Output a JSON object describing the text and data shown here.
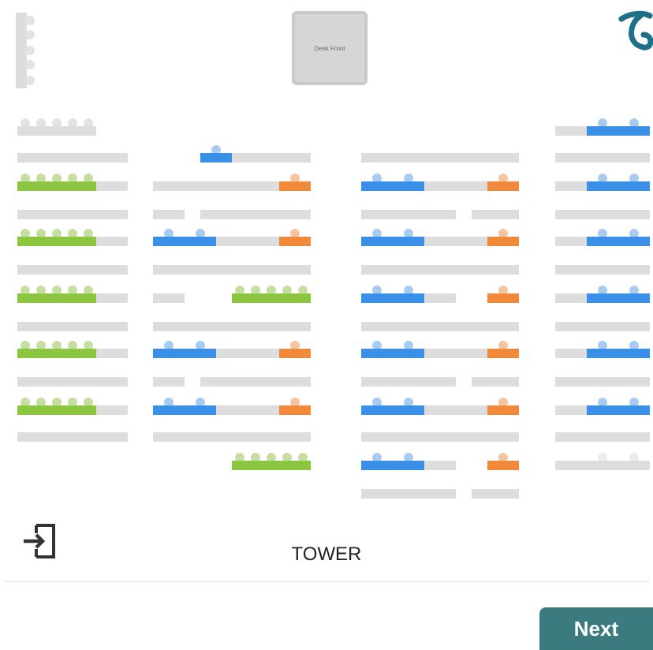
{
  "side_desk": {
    "seats": [
      {
        "kind": "closed"
      },
      {
        "kind": "closed"
      },
      {
        "kind": "closed"
      },
      {
        "kind": "closed"
      },
      {
        "kind": "closed"
      }
    ]
  },
  "desk_front": {
    "label": "Desk Front"
  },
  "plan": {
    "columns": [
      {
        "rows": [
          {
            "seats": [
              {
                "kind": "closed"
              },
              {
                "kind": "closed"
              },
              {
                "kind": "closed"
              },
              {
                "kind": "closed"
              },
              {
                "kind": "closed"
              },
              {
                "kind": "gap"
              },
              {
                "kind": "gap"
              }
            ]
          },
          {
            "seats": [
              {
                "kind": "blocked"
              },
              {
                "kind": "blocked"
              },
              {
                "kind": "blocked"
              },
              {
                "kind": "blocked"
              },
              {
                "kind": "blocked"
              },
              {
                "kind": "blocked"
              },
              {
                "kind": "blocked"
              }
            ]
          },
          {
            "seats": [
              {
                "kind": "free"
              },
              {
                "kind": "free"
              },
              {
                "kind": "free"
              },
              {
                "kind": "free"
              },
              {
                "kind": "free"
              },
              {
                "kind": "blocked"
              },
              {
                "kind": "blocked"
              }
            ]
          },
          {
            "seats": [
              {
                "kind": "blocked"
              },
              {
                "kind": "blocked"
              },
              {
                "kind": "blocked"
              },
              {
                "kind": "blocked"
              },
              {
                "kind": "blocked"
              },
              {
                "kind": "blocked"
              },
              {
                "kind": "blocked"
              }
            ]
          },
          {
            "seats": [
              {
                "kind": "free"
              },
              {
                "kind": "free"
              },
              {
                "kind": "free"
              },
              {
                "kind": "free"
              },
              {
                "kind": "free"
              },
              {
                "kind": "blocked"
              },
              {
                "kind": "blocked"
              }
            ]
          },
          {
            "seats": [
              {
                "kind": "blocked"
              },
              {
                "kind": "blocked"
              },
              {
                "kind": "blocked"
              },
              {
                "kind": "blocked"
              },
              {
                "kind": "blocked"
              },
              {
                "kind": "blocked"
              },
              {
                "kind": "blocked"
              }
            ]
          },
          {
            "seats": [
              {
                "kind": "free"
              },
              {
                "kind": "free"
              },
              {
                "kind": "free"
              },
              {
                "kind": "free"
              },
              {
                "kind": "free"
              },
              {
                "kind": "blocked"
              },
              {
                "kind": "blocked"
              }
            ]
          },
          {
            "seats": [
              {
                "kind": "blocked"
              },
              {
                "kind": "blocked"
              },
              {
                "kind": "blocked"
              },
              {
                "kind": "blocked"
              },
              {
                "kind": "blocked"
              },
              {
                "kind": "blocked"
              },
              {
                "kind": "blocked"
              }
            ]
          },
          {
            "seats": [
              {
                "kind": "free"
              },
              {
                "kind": "free"
              },
              {
                "kind": "free"
              },
              {
                "kind": "free"
              },
              {
                "kind": "free"
              },
              {
                "kind": "blocked"
              },
              {
                "kind": "blocked"
              }
            ]
          },
          {
            "seats": [
              {
                "kind": "blocked"
              },
              {
                "kind": "blocked"
              },
              {
                "kind": "blocked"
              },
              {
                "kind": "blocked"
              },
              {
                "kind": "blocked"
              },
              {
                "kind": "blocked"
              },
              {
                "kind": "blocked"
              }
            ]
          },
          {
            "seats": [
              {
                "kind": "free"
              },
              {
                "kind": "free"
              },
              {
                "kind": "free"
              },
              {
                "kind": "free"
              },
              {
                "kind": "free"
              },
              {
                "kind": "blocked"
              },
              {
                "kind": "blocked"
              }
            ]
          },
          {
            "seats": [
              {
                "kind": "blocked"
              },
              {
                "kind": "blocked"
              },
              {
                "kind": "blocked"
              },
              {
                "kind": "blocked"
              },
              {
                "kind": "blocked"
              },
              {
                "kind": "blocked"
              },
              {
                "kind": "blocked"
              }
            ]
          }
        ]
      },
      {
        "rows": [
          {
            "seats": [
              {
                "kind": "gap"
              }
            ]
          },
          {
            "seats": [
              {
                "kind": "gap"
              },
              {
                "kind": "gap"
              },
              {
                "kind": "gap"
              },
              {
                "kind": "booked"
              },
              {
                "kind": "blocked"
              },
              {
                "kind": "blocked"
              },
              {
                "kind": "blocked"
              },
              {
                "kind": "blocked"
              },
              {
                "kind": "blocked"
              }
            ]
          },
          {
            "seats": [
              {
                "kind": "blocked"
              },
              {
                "kind": "blocked"
              },
              {
                "kind": "blocked"
              },
              {
                "kind": "blocked"
              },
              {
                "kind": "blocked"
              },
              {
                "kind": "blocked"
              },
              {
                "kind": "blocked"
              },
              {
                "kind": "blocked"
              },
              {
                "kind": "selected"
              }
            ]
          },
          {
            "seats": [
              {
                "kind": "blocked"
              },
              {
                "kind": "blocked"
              },
              {
                "kind": "gap"
              },
              {
                "kind": "blocked"
              },
              {
                "kind": "blocked"
              },
              {
                "kind": "blocked"
              },
              {
                "kind": "blocked"
              },
              {
                "kind": "blocked"
              },
              {
                "kind": "blocked"
              },
              {
                "kind": "blocked"
              }
            ]
          },
          {
            "seats": [
              {
                "kind": "booked"
              },
              {
                "kind": "booked"
              },
              {
                "kind": "blocked"
              },
              {
                "kind": "blocked"
              },
              {
                "kind": "blocked"
              },
              {
                "kind": "blocked"
              },
              {
                "kind": "selected"
              }
            ]
          },
          {
            "seats": [
              {
                "kind": "blocked"
              },
              {
                "kind": "blocked"
              },
              {
                "kind": "blocked"
              },
              {
                "kind": "blocked"
              },
              {
                "kind": "blocked"
              },
              {
                "kind": "blocked"
              },
              {
                "kind": "blocked"
              },
              {
                "kind": "blocked"
              },
              {
                "kind": "blocked"
              },
              {
                "kind": "blocked"
              }
            ]
          },
          {
            "seats": [
              {
                "kind": "blocked"
              },
              {
                "kind": "blocked"
              },
              {
                "kind": "gap"
              },
              {
                "kind": "gap"
              },
              {
                "kind": "gap"
              },
              {
                "kind": "free"
              },
              {
                "kind": "free"
              },
              {
                "kind": "free"
              },
              {
                "kind": "free"
              },
              {
                "kind": "free"
              }
            ]
          },
          {
            "seats": [
              {
                "kind": "blocked"
              },
              {
                "kind": "blocked"
              },
              {
                "kind": "blocked"
              },
              {
                "kind": "blocked"
              },
              {
                "kind": "blocked"
              },
              {
                "kind": "blocked"
              },
              {
                "kind": "blocked"
              },
              {
                "kind": "blocked"
              },
              {
                "kind": "blocked"
              },
              {
                "kind": "blocked"
              }
            ]
          },
          {
            "seats": [
              {
                "kind": "booked"
              },
              {
                "kind": "booked"
              },
              {
                "kind": "blocked"
              },
              {
                "kind": "blocked"
              },
              {
                "kind": "blocked"
              },
              {
                "kind": "blocked"
              },
              {
                "kind": "selected"
              }
            ]
          },
          {
            "seats": [
              {
                "kind": "blocked"
              },
              {
                "kind": "blocked"
              },
              {
                "kind": "gap"
              },
              {
                "kind": "blocked"
              },
              {
                "kind": "blocked"
              },
              {
                "kind": "blocked"
              },
              {
                "kind": "blocked"
              },
              {
                "kind": "blocked"
              },
              {
                "kind": "blocked"
              },
              {
                "kind": "blocked"
              }
            ]
          },
          {
            "seats": [
              {
                "kind": "booked"
              },
              {
                "kind": "booked"
              },
              {
                "kind": "blocked"
              },
              {
                "kind": "blocked"
              },
              {
                "kind": "blocked"
              },
              {
                "kind": "blocked"
              },
              {
                "kind": "selected"
              }
            ]
          },
          {
            "seats": [
              {
                "kind": "blocked"
              },
              {
                "kind": "blocked"
              },
              {
                "kind": "blocked"
              },
              {
                "kind": "blocked"
              },
              {
                "kind": "blocked"
              },
              {
                "kind": "blocked"
              },
              {
                "kind": "blocked"
              },
              {
                "kind": "blocked"
              },
              {
                "kind": "blocked"
              },
              {
                "kind": "blocked"
              }
            ]
          },
          {
            "seats": [
              {
                "kind": "gap"
              },
              {
                "kind": "gap"
              },
              {
                "kind": "gap"
              },
              {
                "kind": "gap"
              },
              {
                "kind": "gap"
              },
              {
                "kind": "free"
              },
              {
                "kind": "free"
              },
              {
                "kind": "free"
              },
              {
                "kind": "free"
              },
              {
                "kind": "free"
              }
            ]
          }
        ]
      },
      {
        "rows": [
          {
            "seats": [
              {
                "kind": "gap"
              }
            ]
          },
          {
            "seats": [
              {
                "kind": "blocked"
              },
              {
                "kind": "blocked"
              },
              {
                "kind": "blocked"
              },
              {
                "kind": "blocked"
              },
              {
                "kind": "blocked"
              },
              {
                "kind": "blocked"
              },
              {
                "kind": "blocked"
              },
              {
                "kind": "blocked"
              },
              {
                "kind": "blocked"
              },
              {
                "kind": "blocked"
              }
            ]
          },
          {
            "seats": [
              {
                "kind": "booked"
              },
              {
                "kind": "booked"
              },
              {
                "kind": "blocked"
              },
              {
                "kind": "blocked"
              },
              {
                "kind": "blocked"
              },
              {
                "kind": "blocked"
              },
              {
                "kind": "selected"
              }
            ]
          },
          {
            "seats": [
              {
                "kind": "blocked"
              },
              {
                "kind": "blocked"
              },
              {
                "kind": "blocked"
              },
              {
                "kind": "blocked"
              },
              {
                "kind": "blocked"
              },
              {
                "kind": "blocked"
              },
              {
                "kind": "gap"
              },
              {
                "kind": "blocked"
              },
              {
                "kind": "blocked"
              },
              {
                "kind": "blocked"
              }
            ]
          },
          {
            "seats": [
              {
                "kind": "booked"
              },
              {
                "kind": "booked"
              },
              {
                "kind": "blocked"
              },
              {
                "kind": "blocked"
              },
              {
                "kind": "blocked"
              },
              {
                "kind": "blocked"
              },
              {
                "kind": "selected"
              }
            ]
          },
          {
            "seats": [
              {
                "kind": "blocked"
              },
              {
                "kind": "blocked"
              },
              {
                "kind": "blocked"
              },
              {
                "kind": "blocked"
              },
              {
                "kind": "blocked"
              },
              {
                "kind": "blocked"
              },
              {
                "kind": "blocked"
              },
              {
                "kind": "blocked"
              },
              {
                "kind": "blocked"
              },
              {
                "kind": "blocked"
              }
            ]
          },
          {
            "seats": [
              {
                "kind": "booked"
              },
              {
                "kind": "booked"
              },
              {
                "kind": "blocked"
              },
              {
                "kind": "blocked"
              },
              {
                "kind": "gap"
              },
              {
                "kind": "gap"
              },
              {
                "kind": "selected"
              }
            ]
          },
          {
            "seats": [
              {
                "kind": "blocked"
              },
              {
                "kind": "blocked"
              },
              {
                "kind": "blocked"
              },
              {
                "kind": "blocked"
              },
              {
                "kind": "blocked"
              },
              {
                "kind": "blocked"
              },
              {
                "kind": "blocked"
              },
              {
                "kind": "blocked"
              },
              {
                "kind": "blocked"
              },
              {
                "kind": "blocked"
              }
            ]
          },
          {
            "seats": [
              {
                "kind": "booked"
              },
              {
                "kind": "booked"
              },
              {
                "kind": "blocked"
              },
              {
                "kind": "blocked"
              },
              {
                "kind": "blocked"
              },
              {
                "kind": "blocked"
              },
              {
                "kind": "selected"
              }
            ]
          },
          {
            "seats": [
              {
                "kind": "blocked"
              },
              {
                "kind": "blocked"
              },
              {
                "kind": "blocked"
              },
              {
                "kind": "blocked"
              },
              {
                "kind": "blocked"
              },
              {
                "kind": "blocked"
              },
              {
                "kind": "gap"
              },
              {
                "kind": "blocked"
              },
              {
                "kind": "blocked"
              },
              {
                "kind": "blocked"
              }
            ]
          },
          {
            "seats": [
              {
                "kind": "booked"
              },
              {
                "kind": "booked"
              },
              {
                "kind": "blocked"
              },
              {
                "kind": "blocked"
              },
              {
                "kind": "blocked"
              },
              {
                "kind": "blocked"
              },
              {
                "kind": "selected"
              }
            ]
          },
          {
            "seats": [
              {
                "kind": "blocked"
              },
              {
                "kind": "blocked"
              },
              {
                "kind": "blocked"
              },
              {
                "kind": "blocked"
              },
              {
                "kind": "blocked"
              },
              {
                "kind": "blocked"
              },
              {
                "kind": "blocked"
              },
              {
                "kind": "blocked"
              },
              {
                "kind": "blocked"
              },
              {
                "kind": "blocked"
              }
            ]
          },
          {
            "seats": [
              {
                "kind": "booked"
              },
              {
                "kind": "booked"
              },
              {
                "kind": "blocked"
              },
              {
                "kind": "blocked"
              },
              {
                "kind": "gap"
              },
              {
                "kind": "gap"
              },
              {
                "kind": "selected"
              }
            ]
          },
          {
            "seats": [
              {
                "kind": "blocked"
              },
              {
                "kind": "blocked"
              },
              {
                "kind": "blocked"
              },
              {
                "kind": "blocked"
              },
              {
                "kind": "blocked"
              },
              {
                "kind": "blocked"
              },
              {
                "kind": "gap"
              },
              {
                "kind": "blocked"
              },
              {
                "kind": "blocked"
              },
              {
                "kind": "blocked"
              }
            ]
          }
        ]
      },
      {
        "rows": [
          {
            "seats": [
              {
                "kind": "blocked"
              },
              {
                "kind": "blocked"
              },
              {
                "kind": "booked"
              },
              {
                "kind": "booked"
              }
            ]
          },
          {
            "seats": [
              {
                "kind": "blocked"
              },
              {
                "kind": "blocked"
              },
              {
                "kind": "blocked"
              },
              {
                "kind": "blocked"
              },
              {
                "kind": "blocked"
              },
              {
                "kind": "blocked"
              }
            ]
          },
          {
            "seats": [
              {
                "kind": "blocked"
              },
              {
                "kind": "blocked"
              },
              {
                "kind": "booked"
              },
              {
                "kind": "booked"
              }
            ]
          },
          {
            "seats": [
              {
                "kind": "blocked"
              },
              {
                "kind": "blocked"
              },
              {
                "kind": "blocked"
              },
              {
                "kind": "blocked"
              },
              {
                "kind": "blocked"
              },
              {
                "kind": "blocked"
              }
            ]
          },
          {
            "seats": [
              {
                "kind": "blocked"
              },
              {
                "kind": "blocked"
              },
              {
                "kind": "booked"
              },
              {
                "kind": "booked"
              }
            ]
          },
          {
            "seats": [
              {
                "kind": "blocked"
              },
              {
                "kind": "blocked"
              },
              {
                "kind": "blocked"
              },
              {
                "kind": "blocked"
              },
              {
                "kind": "blocked"
              },
              {
                "kind": "blocked"
              }
            ]
          },
          {
            "seats": [
              {
                "kind": "blocked"
              },
              {
                "kind": "blocked"
              },
              {
                "kind": "booked"
              },
              {
                "kind": "booked"
              }
            ]
          },
          {
            "seats": [
              {
                "kind": "blocked"
              },
              {
                "kind": "blocked"
              },
              {
                "kind": "blocked"
              },
              {
                "kind": "blocked"
              },
              {
                "kind": "blocked"
              },
              {
                "kind": "blocked"
              }
            ]
          },
          {
            "seats": [
              {
                "kind": "blocked"
              },
              {
                "kind": "blocked"
              },
              {
                "kind": "booked"
              },
              {
                "kind": "booked"
              }
            ]
          },
          {
            "seats": [
              {
                "kind": "blocked"
              },
              {
                "kind": "blocked"
              },
              {
                "kind": "blocked"
              },
              {
                "kind": "blocked"
              },
              {
                "kind": "blocked"
              },
              {
                "kind": "blocked"
              }
            ]
          },
          {
            "seats": [
              {
                "kind": "blocked"
              },
              {
                "kind": "blocked"
              },
              {
                "kind": "booked"
              },
              {
                "kind": "booked"
              }
            ]
          },
          {
            "seats": [
              {
                "kind": "blocked"
              },
              {
                "kind": "blocked"
              },
              {
                "kind": "blocked"
              },
              {
                "kind": "blocked"
              },
              {
                "kind": "blocked"
              },
              {
                "kind": "blocked"
              }
            ]
          },
          {
            "seats": [
              {
                "kind": "blocked"
              },
              {
                "kind": "blocked"
              },
              {
                "kind": "held"
              },
              {
                "kind": "held"
              }
            ]
          }
        ]
      }
    ]
  },
  "footer": {
    "title": "TOWER"
  },
  "buttons": [
    {
      "label": "Next"
    }
  ]
}
